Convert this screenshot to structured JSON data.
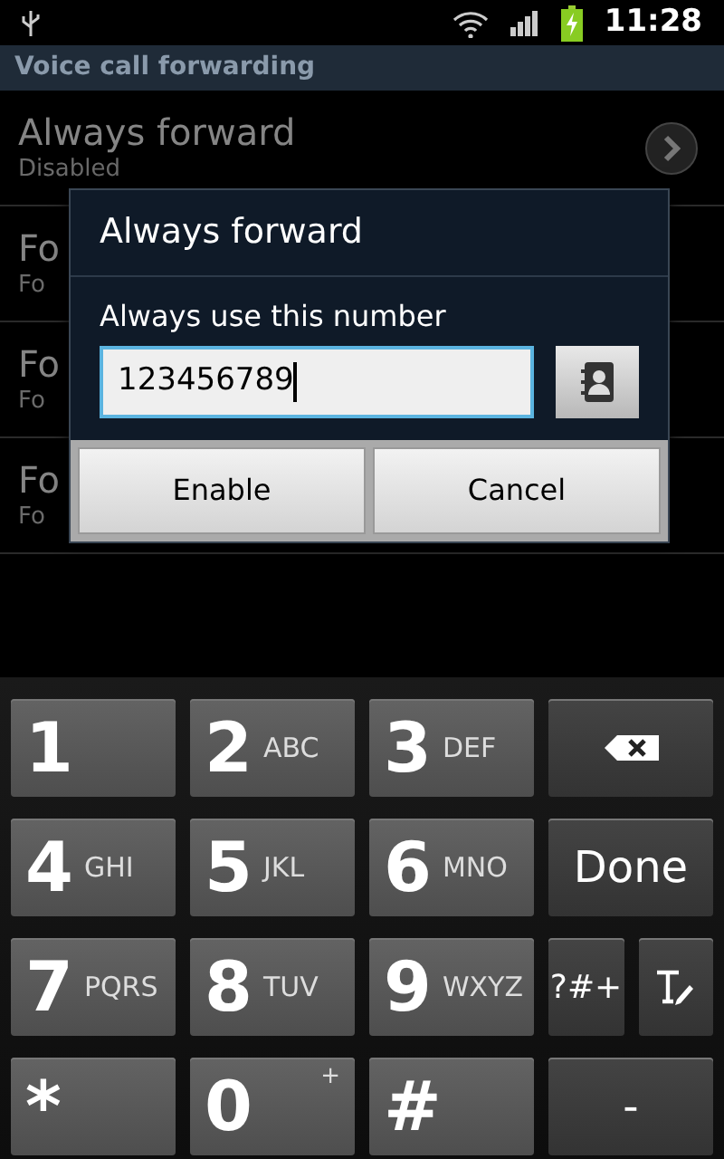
{
  "status_bar": {
    "time": "11:28"
  },
  "header": {
    "title": "Voice call forwarding"
  },
  "rows": [
    {
      "title": "Always forward",
      "subtitle": "Disabled",
      "chevron": true
    },
    {
      "title": "Fo",
      "subtitle": "Fo",
      "chevron": false
    },
    {
      "title": "Fo",
      "subtitle": "Fo",
      "chevron": false
    },
    {
      "title": "Fo",
      "subtitle": "Fo",
      "chevron": false
    }
  ],
  "dialog": {
    "title": "Always forward",
    "label": "Always use this number",
    "value": "123456789",
    "buttons": [
      "Enable",
      "Cancel"
    ]
  },
  "keyboard": {
    "keys": [
      {
        "kind": "digit",
        "label": "1"
      },
      {
        "kind": "digit",
        "label": "2",
        "letters": "ABC"
      },
      {
        "kind": "digit",
        "label": "3",
        "letters": "DEF"
      },
      {
        "kind": "backspace"
      },
      {
        "kind": "digit",
        "label": "4",
        "letters": "GHI"
      },
      {
        "kind": "digit",
        "label": "5",
        "letters": "JKL"
      },
      {
        "kind": "digit",
        "label": "6",
        "letters": "MNO"
      },
      {
        "kind": "action",
        "label": "Done"
      },
      {
        "kind": "digit",
        "label": "7",
        "letters": "PQRS"
      },
      {
        "kind": "digit",
        "label": "8",
        "letters": "TUV"
      },
      {
        "kind": "digit",
        "label": "9",
        "letters": "WXYZ"
      },
      {
        "kind": "split",
        "label": "?#+"
      },
      {
        "kind": "digit",
        "label": "*"
      },
      {
        "kind": "digit",
        "label": "0",
        "extra": "+"
      },
      {
        "kind": "digit",
        "label": "#"
      },
      {
        "kind": "action",
        "label": "-"
      }
    ]
  }
}
